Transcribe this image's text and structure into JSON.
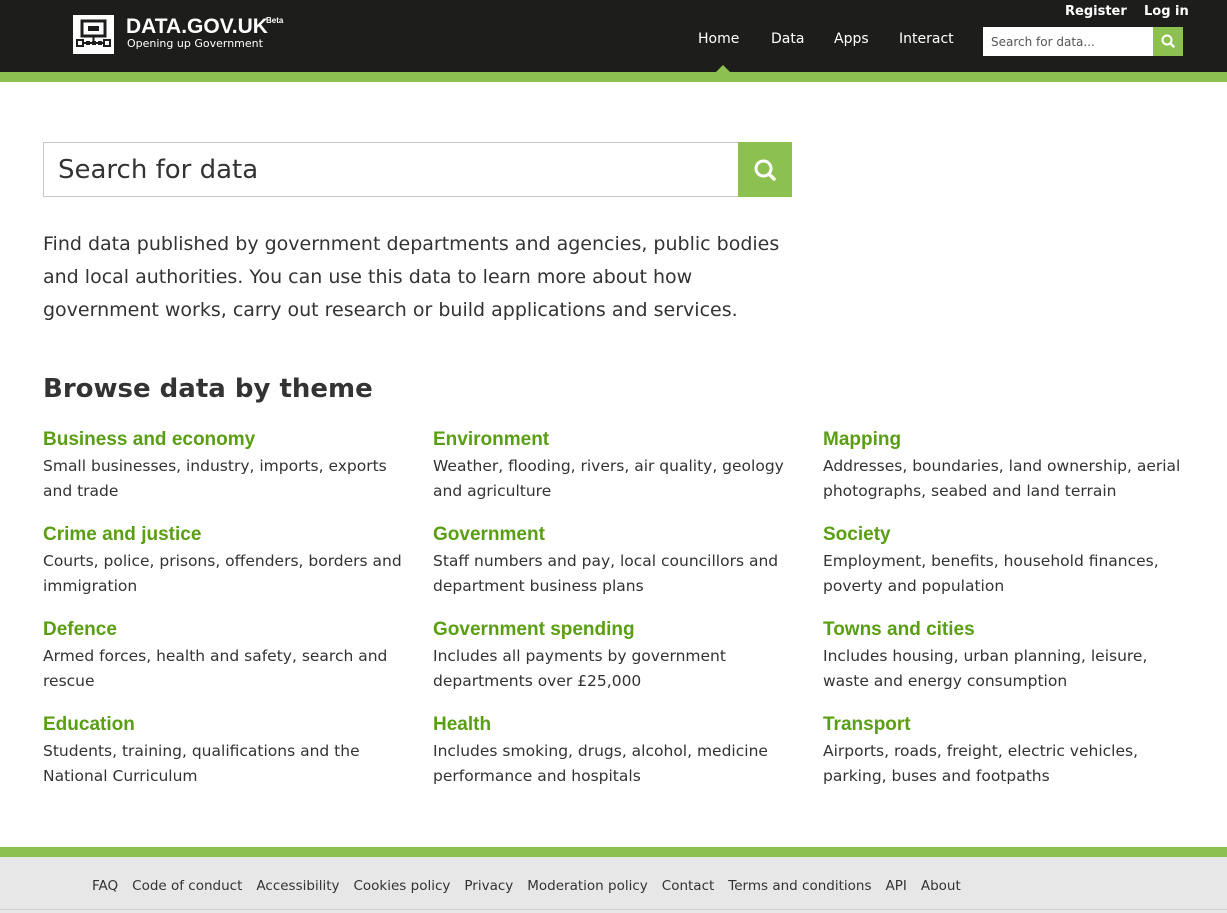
{
  "header": {
    "logo_icon": "dgu-logo-icon",
    "title": "DATA.GOV.UK",
    "beta": "Beta",
    "tagline": "Opening up Government",
    "register": "Register",
    "login": "Log in",
    "nav": [
      "Home",
      "Data",
      "Apps",
      "Interact"
    ],
    "active_nav": "Home",
    "search_placeholder": "Search for data...",
    "search_icon": "search-icon"
  },
  "main": {
    "search_placeholder": "Search for data",
    "intro": "Find data published by government departments and agencies, public bodies and local authorities. You can use this data to learn more about how government works, carry out research or build applications and services.",
    "browse_title": "Browse data by theme",
    "themes": [
      {
        "name": "Business and economy",
        "desc": "Small businesses, industry, imports, exports and trade"
      },
      {
        "name": "Environment",
        "desc": "Weather, flooding, rivers, air quality, geology and agriculture"
      },
      {
        "name": "Mapping",
        "desc": "Addresses, boundaries, land ownership, aerial photographs, seabed and land terrain"
      },
      {
        "name": "Crime and justice",
        "desc": "Courts, police, prisons, offenders, borders and immigration"
      },
      {
        "name": "Government",
        "desc": "Staff numbers and pay, local councillors and department business plans"
      },
      {
        "name": "Society",
        "desc": "Employment, benefits, household finances, poverty and population"
      },
      {
        "name": "Defence",
        "desc": "Armed forces, health and safety, search and rescue"
      },
      {
        "name": "Government spending",
        "desc": "Includes all payments by government departments over £25,000"
      },
      {
        "name": "Towns and cities",
        "desc": "Includes housing, urban planning, leisure, waste and energy consumption"
      },
      {
        "name": "Education",
        "desc": "Students, training, qualifications and the National Curriculum"
      },
      {
        "name": "Health",
        "desc": "Includes smoking, drugs, alcohol, medicine performance and hospitals"
      },
      {
        "name": "Transport",
        "desc": "Airports, roads, freight, electric vehicles, parking, buses and footpaths"
      }
    ]
  },
  "footer": {
    "links": [
      "FAQ",
      "Code of conduct",
      "Accessibility",
      "Cookies policy",
      "Privacy",
      "Moderation policy",
      "Contact",
      "Terms and conditions",
      "API",
      "About"
    ]
  },
  "colors": {
    "header_bg": "#1d1d1b",
    "accent_green": "#8cc152",
    "link_green": "#5a9e14",
    "footer_bg": "#e7e7e7"
  }
}
